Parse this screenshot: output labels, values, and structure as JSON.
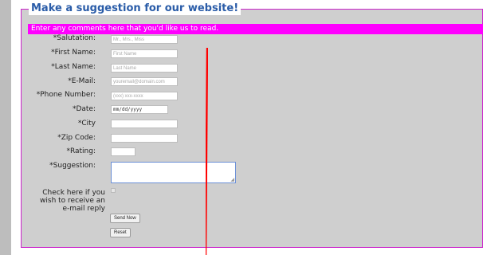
{
  "form": {
    "title": "Make a suggestion for our website!",
    "banner": "Enter any comments here that you'd like us to read.",
    "fields": [
      {
        "label": "*Salutation:",
        "placeholder": "Mr., Mrs., Miss"
      },
      {
        "label": "*First Name:",
        "placeholder": "First Name"
      },
      {
        "label": "*Last Name:",
        "placeholder": "Last Name"
      },
      {
        "label": "*E-Mail:",
        "placeholder": "youremail@domain.com"
      },
      {
        "label": "*Phone Number:",
        "placeholder": "(xxx) xxx-xxxx"
      },
      {
        "label": "*Date:",
        "placeholder": "mm/dd/yyyy"
      },
      {
        "label": "*City",
        "placeholder": ""
      },
      {
        "label": "*Zip Code:",
        "placeholder": ""
      },
      {
        "label": "*Rating:",
        "placeholder": ""
      },
      {
        "label": "*Suggestion:",
        "placeholder": ""
      }
    ],
    "checkbox_label": "Check here if you wish to receive an e-mail reply",
    "send_label": "Send Now",
    "reset_label": "Reset"
  },
  "colors": {
    "frame_border": "#cc22cc",
    "banner_bg": "#ff00ff",
    "title": "#2a5ca8",
    "annotation_line": "#ff0000"
  }
}
